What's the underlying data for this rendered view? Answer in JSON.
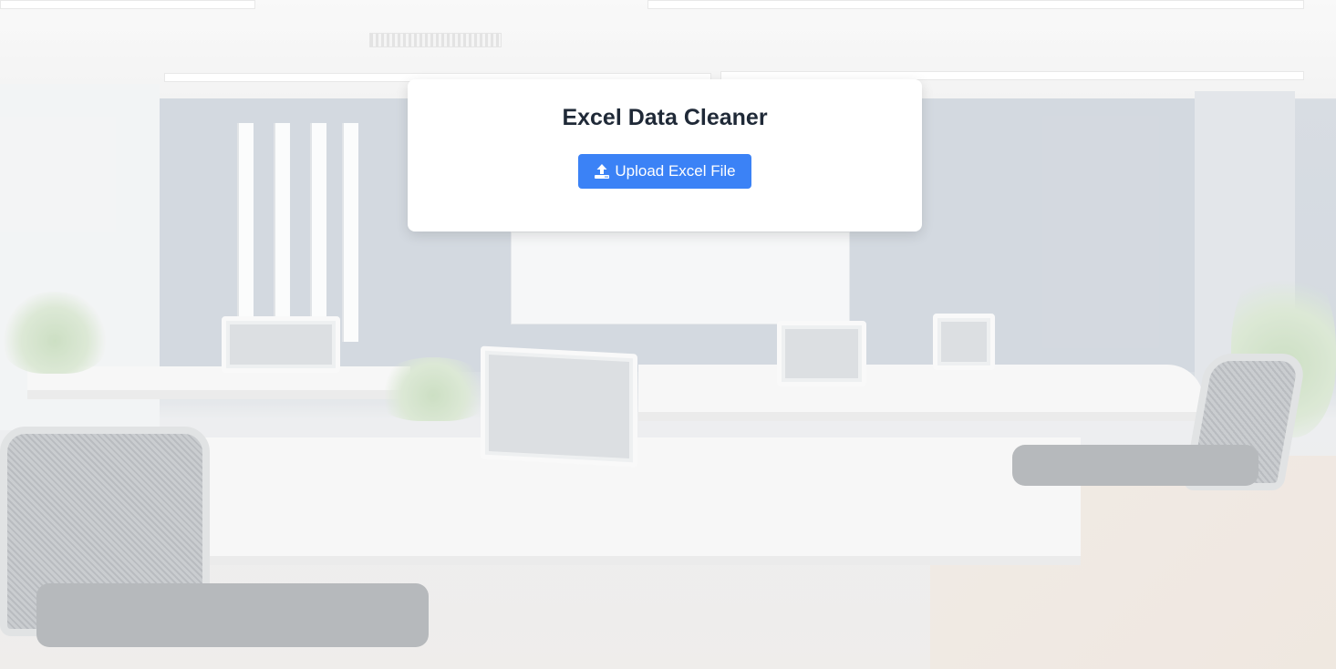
{
  "card": {
    "title": "Excel Data Cleaner",
    "upload_button": {
      "label": "Upload Excel File",
      "icon": "upload-icon"
    }
  },
  "colors": {
    "primary_button": "#3b82f6",
    "title_text": "#1f2937",
    "card_background": "#ffffff"
  },
  "background": {
    "description_icon": "office-background-image"
  }
}
